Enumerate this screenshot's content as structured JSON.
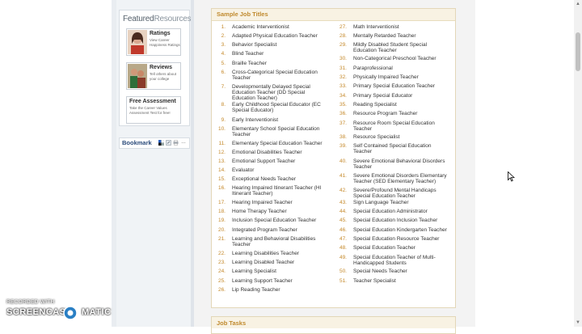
{
  "sidebar": {
    "featured_title_a": "Featured",
    "featured_title_b": "Resources",
    "resources": [
      {
        "title": "Ratings",
        "desc": "View Career Happiness Ratings",
        "icon": "woman-photo-icon"
      },
      {
        "title": "Reviews",
        "desc": "Tell others about your college",
        "icon": "students-photo-icon"
      },
      {
        "title": "Free Assessment",
        "desc": "Take the Career Values Assessment Test for free!",
        "icon": ""
      }
    ],
    "bookmark_label": "Bookmark"
  },
  "panel": {
    "title": "Sample Job Titles",
    "column1": [
      {
        "num": "1.",
        "text": "Academic Interventionist"
      },
      {
        "num": "2.",
        "text": "Adapted Physical Education Teacher"
      },
      {
        "num": "3.",
        "text": "Behavior Specialist"
      },
      {
        "num": "4.",
        "text": "Blind Teacher"
      },
      {
        "num": "5.",
        "text": "Braille Teacher"
      },
      {
        "num": "6.",
        "text": "Cross-Categorical Special Education Teacher"
      },
      {
        "num": "7.",
        "text": "Developmentally Delayed Special Education Teacher (DD Special Education Teacher)"
      },
      {
        "num": "8.",
        "text": "Early Childhood Special Educator (EC Special Educator)"
      },
      {
        "num": "9.",
        "text": "Early Interventionist"
      },
      {
        "num": "10.",
        "text": "Elementary School Special Education Teacher"
      },
      {
        "num": "11.",
        "text": "Elementary Special Education Teacher"
      },
      {
        "num": "12.",
        "text": "Emotional Disabilities Teacher"
      },
      {
        "num": "13.",
        "text": "Emotional Support Teacher"
      },
      {
        "num": "14.",
        "text": "Evaluator"
      },
      {
        "num": "15.",
        "text": "Exceptional Needs Teacher"
      },
      {
        "num": "16.",
        "text": "Hearing Impaired Itinerant Teacher (HI Itinerant Teacher)"
      },
      {
        "num": "17.",
        "text": "Hearing Impaired Teacher"
      },
      {
        "num": "18.",
        "text": "Home Therapy Teacher"
      },
      {
        "num": "19.",
        "text": "Inclusion Special Education Teacher"
      },
      {
        "num": "20.",
        "text": "Integrated Program Teacher"
      },
      {
        "num": "21.",
        "text": "Learning and Behavioral Disabilities Teacher"
      },
      {
        "num": "22.",
        "text": "Learning Disabilities Teacher"
      },
      {
        "num": "23.",
        "text": "Learning Disabled Teacher"
      },
      {
        "num": "24.",
        "text": "Learning Specialist"
      },
      {
        "num": "25.",
        "text": "Learning Support Teacher"
      },
      {
        "num": "26.",
        "text": "Lip Reading Teacher"
      }
    ],
    "column2": [
      {
        "num": "27.",
        "text": "Math Interventionist"
      },
      {
        "num": "28.",
        "text": "Mentally Retarded Teacher"
      },
      {
        "num": "29.",
        "text": "Mildly Disabled Student Special Education Teacher"
      },
      {
        "num": "30.",
        "text": "Non-Categorical Preschool Teacher"
      },
      {
        "num": "31.",
        "text": "Paraprofessional"
      },
      {
        "num": "32.",
        "text": "Physically Impaired Teacher"
      },
      {
        "num": "33.",
        "text": "Primary Special Education Teacher"
      },
      {
        "num": "34.",
        "text": "Primary Special Educator"
      },
      {
        "num": "35.",
        "text": "Reading Specialist"
      },
      {
        "num": "36.",
        "text": "Resource Program Teacher"
      },
      {
        "num": "37.",
        "text": "Resource Room Special Education Teacher"
      },
      {
        "num": "38.",
        "text": "Resource Specialist"
      },
      {
        "num": "39.",
        "text": "Self Contained Special Education Teacher"
      },
      {
        "num": "40.",
        "text": "Severe Emotional Behavioral Disorders Teacher"
      },
      {
        "num": "41.",
        "text": "Severe Emotional Disorders Elementary Teacher (SED Elementary Teacher)"
      },
      {
        "num": "42.",
        "text": "Severe/Profound Mental Handicaps Special Education Teacher"
      },
      {
        "num": "43.",
        "text": "Sign Language Teacher"
      },
      {
        "num": "44.",
        "text": "Special Education Administrator"
      },
      {
        "num": "45.",
        "text": "Special Education Inclusion Teacher"
      },
      {
        "num": "46.",
        "text": "Special Education Kindergarten Teacher"
      },
      {
        "num": "47.",
        "text": "Special Education Resource Teacher"
      },
      {
        "num": "48.",
        "text": "Special Education Teacher"
      },
      {
        "num": "49.",
        "text": "Special Education Teacher of Multi-Handicapped Students"
      },
      {
        "num": "50.",
        "text": "Special Needs Teacher"
      },
      {
        "num": "51.",
        "text": "Teacher Specialist"
      }
    ]
  },
  "panel2": {
    "title": "Job Tasks"
  },
  "watermark": {
    "line1": "RECORDED WITH",
    "brand_a": "SCREENCAST",
    "brand_b": "MATIC"
  },
  "colors": {
    "accent": "#c5892a",
    "panel_header": "#f8f2e3"
  }
}
